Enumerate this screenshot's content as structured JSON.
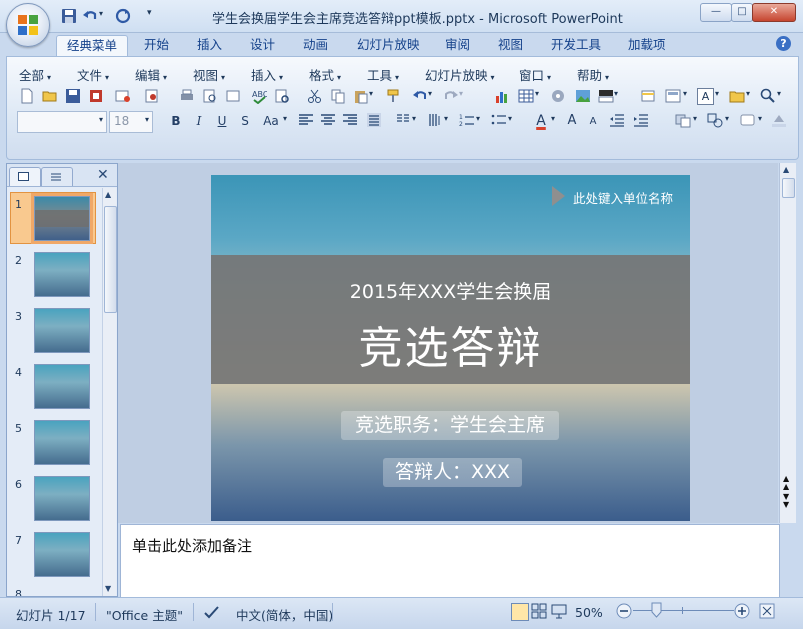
{
  "window": {
    "title": "学生会换届学生会主席竞选答辩ppt模板.pptx - Microsoft PowerPoint",
    "minimize_label": "—",
    "maximize_label": "□",
    "close_label": "✕"
  },
  "quick_access": {
    "customize_label": "▾"
  },
  "tabs": [
    {
      "label": "经典菜单"
    },
    {
      "label": "开始"
    },
    {
      "label": "插入"
    },
    {
      "label": "设计"
    },
    {
      "label": "动画"
    },
    {
      "label": "幻灯片放映"
    },
    {
      "label": "审阅"
    },
    {
      "label": "视图"
    },
    {
      "label": "开发工具"
    },
    {
      "label": "加载项"
    }
  ],
  "menu_bar": [
    {
      "label": "全部"
    },
    {
      "label": "文件"
    },
    {
      "label": "编辑"
    },
    {
      "label": "视图"
    },
    {
      "label": "插入"
    },
    {
      "label": "格式"
    },
    {
      "label": "工具"
    },
    {
      "label": "幻灯片放映"
    },
    {
      "label": "窗口"
    },
    {
      "label": "帮助"
    }
  ],
  "toolbar": {
    "font_size": "18",
    "bold": "B",
    "italic": "I",
    "underline": "U",
    "shadow": "S",
    "change_case": "Aa",
    "font_color": "A",
    "grow_font": "A",
    "shrink_font": "A"
  },
  "panel": {
    "close_label": "✕"
  },
  "thumbnails": [
    {
      "number": "1"
    },
    {
      "number": "2"
    },
    {
      "number": "3"
    },
    {
      "number": "4"
    },
    {
      "number": "5"
    },
    {
      "number": "6"
    },
    {
      "number": "7"
    },
    {
      "number": "8"
    }
  ],
  "slide": {
    "unit_label": "此处键入单位名称",
    "subtitle": "2015年XXX学生会换届",
    "title": "竞选答辩",
    "position_label": "竞选职务：学生会主席",
    "speaker_label": "答辩人：XXX"
  },
  "notes": {
    "placeholder": "单击此处添加备注"
  },
  "status": {
    "slide_counter": "幻灯片 1/17",
    "theme": "\"Office 主题\"",
    "language": "中文(简体，中国)",
    "zoom": "50%"
  },
  "colors": {
    "accent": "#15428b",
    "selected_thumb": "#f9c98f",
    "ribbon_bg": "#dde8f5"
  }
}
